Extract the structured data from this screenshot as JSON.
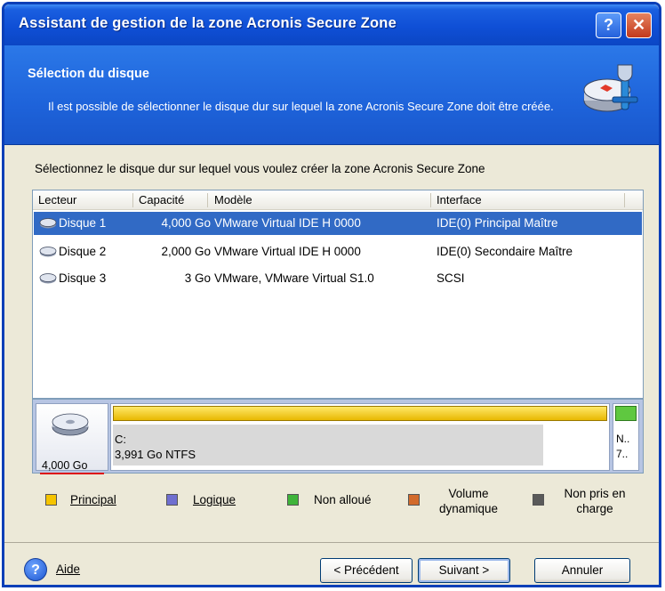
{
  "window": {
    "title": "Assistant de gestion de la zone Acronis Secure Zone",
    "help_button": "?",
    "close_button": "✕"
  },
  "header": {
    "title": "Sélection du disque",
    "description": "Il est possible de sélectionner le disque dur sur lequel la zone Acronis Secure Zone doit être créée.",
    "icon": "disk-tools-icon"
  },
  "instruction": "Sélectionnez le disque dur sur lequel vous voulez créer la zone Acronis Secure Zone",
  "disk_list": {
    "columns": [
      "Lecteur",
      "Capacité",
      "Modèle",
      "Interface"
    ],
    "rows": [
      {
        "drive": "Disque 1",
        "capacity": "4,000 Go",
        "model": "VMware Virtual IDE H 0000",
        "interface": "IDE(0) Principal Maître",
        "selected": true
      },
      {
        "drive": "Disque 2",
        "capacity": "2,000 Go",
        "model": "VMware Virtual IDE H 0000",
        "interface": "IDE(0) Secondaire Maître",
        "selected": false
      },
      {
        "drive": "Disque 3",
        "capacity": "3 Go",
        "model": "VMware, VMware Virtual S1.0",
        "interface": "SCSI",
        "selected": false
      }
    ]
  },
  "disk_map": {
    "disk_size": "4,000 Go",
    "partition_main": {
      "letter": "C:",
      "detail": "3,991 Go  NTFS",
      "used_fraction": 0.87
    },
    "partition_small": {
      "line1": "N..",
      "line2": "7.."
    }
  },
  "legend": [
    {
      "label": "Principal",
      "color": "#f5c400"
    },
    {
      "label": "Logique",
      "color": "#6f6fd0"
    },
    {
      "label": "Non alloué",
      "color": "#3fb43a"
    },
    {
      "label": "Volume dynamique",
      "color": "#d26a2a"
    },
    {
      "label": "Non pris en charge",
      "color": "#5a5a5a"
    }
  ],
  "footer": {
    "help_label": "Aide",
    "back_label": "< Précédent",
    "next_label": "Suivant >",
    "cancel_label": "Annuler"
  },
  "colors": {
    "title_bar": "#0f4fd6",
    "selection": "#316ac5",
    "window_bg": "#ece9d8"
  }
}
